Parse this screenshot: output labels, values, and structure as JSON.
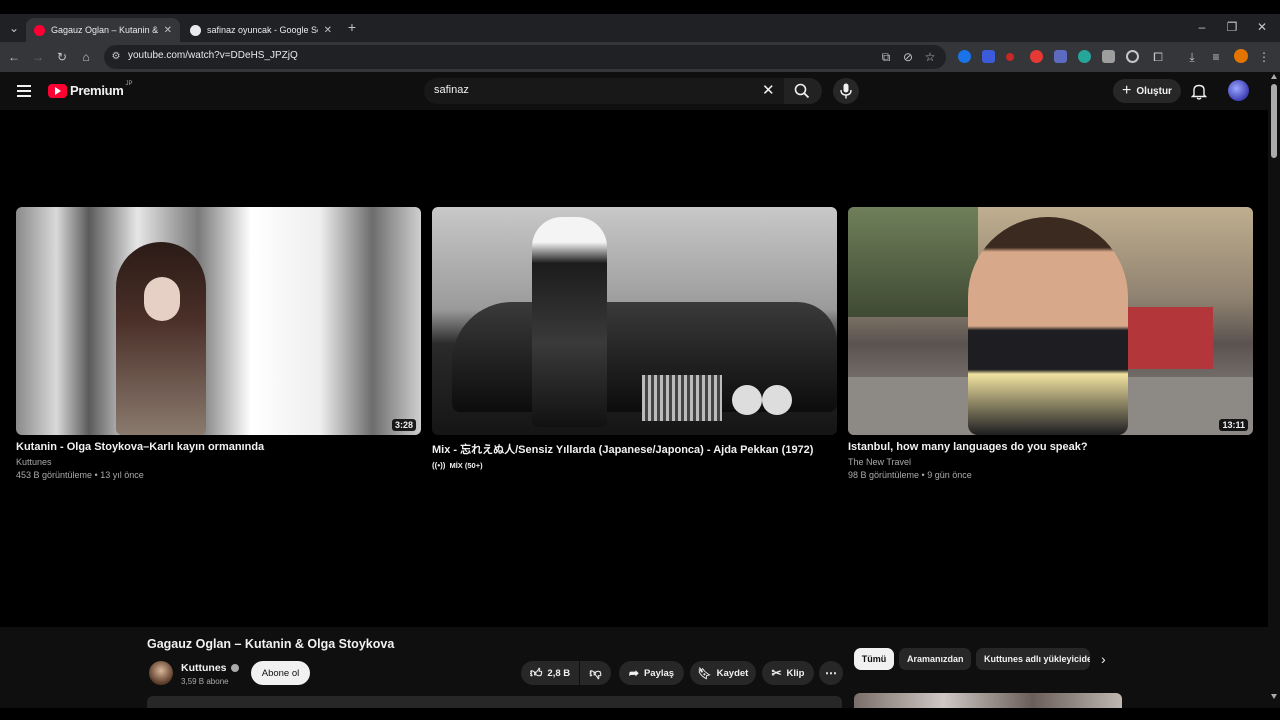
{
  "browser": {
    "tabs": [
      {
        "title": "Gagauz Oglan – Kutanin & Olga",
        "color": "#ff0033"
      },
      {
        "title": "safinaz oyuncak - Google Search",
        "color": "#4285f4"
      }
    ],
    "new_tab": "+",
    "url": "youtube.com/watch?v=DDeHS_JPZjQ"
  },
  "youtube": {
    "logo_text": "Premium",
    "logo_sup": "JP",
    "search_value": "safinaz",
    "create_label": "Oluştur"
  },
  "videos": [
    {
      "title": "Kutanin - Olga Stoykova–Karlı kayın ormanında",
      "channel": "Kuttunes",
      "meta": "453 B görüntüleme • 13 yıl önce",
      "duration": "3:28"
    },
    {
      "title": "Mix - 忘れえぬ人/Sensiz Yıllarda (Japanese/Japonca) - Ajda Pekkan (1972)",
      "channel": "MİX (50+)",
      "meta": "",
      "duration": ""
    },
    {
      "title": "Istanbul, how many languages do you speak?",
      "channel": "The New Travel",
      "meta": "98 B görüntüleme • 9 gün önce",
      "duration": "13:11"
    }
  ],
  "watch": {
    "title": "Gagauz Oglan – Kutanin & Olga Stoykova",
    "channel": "Kuttunes",
    "subscribers": "3,59 B abone",
    "subscribe_label": "Abone ol",
    "likes": "2,8 B",
    "share_label": "Paylaş",
    "save_label": "Kaydet",
    "clip_label": "Klip"
  },
  "chips": [
    "Tümü",
    "Aramanızdan",
    "Kuttunes adlı yükleyiciden"
  ]
}
